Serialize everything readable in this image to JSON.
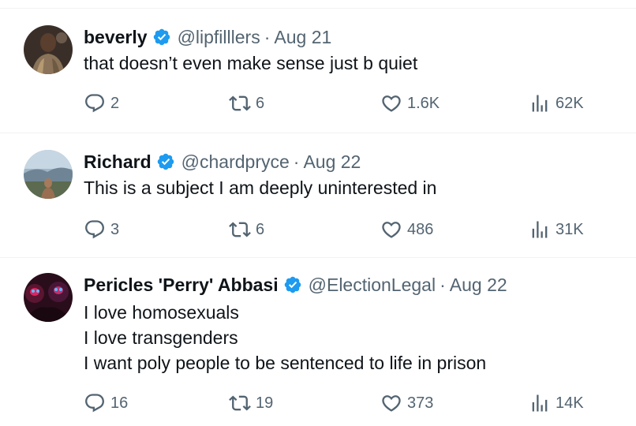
{
  "tweets": [
    {
      "name": "beverly",
      "handle": "@lipfilllers",
      "separator": "·",
      "date": "Aug 21",
      "lines": [
        "that doesn’t even make sense just b quiet"
      ],
      "replies": "2",
      "reposts": "6",
      "likes": "1.6K",
      "views": "62K",
      "verified": true
    },
    {
      "name": "Richard",
      "handle": "@chardpryce",
      "separator": "·",
      "date": "Aug 22",
      "lines": [
        "This is a subject I am deeply uninterested in"
      ],
      "replies": "3",
      "reposts": "6",
      "likes": "486",
      "views": "31K",
      "verified": true
    },
    {
      "name": "Pericles 'Perry' Abbasi",
      "handle": "@ElectionLegal",
      "separator": "·",
      "date": "Aug 22",
      "lines": [
        "I love homosexuals",
        "I love transgenders",
        "I want poly people to be sentenced to life in prison"
      ],
      "replies": "16",
      "reposts": "19",
      "likes": "373",
      "views": "14K",
      "verified": true
    }
  ],
  "icons": {
    "verified": "verified-badge-icon",
    "reply": "reply-icon",
    "repost": "repost-icon",
    "like": "heart-icon",
    "views": "views-icon"
  },
  "colors": {
    "verified_blue": "#1d9bf0",
    "text": "#0f1419",
    "secondary": "#536471",
    "divider": "#eff3f4"
  }
}
